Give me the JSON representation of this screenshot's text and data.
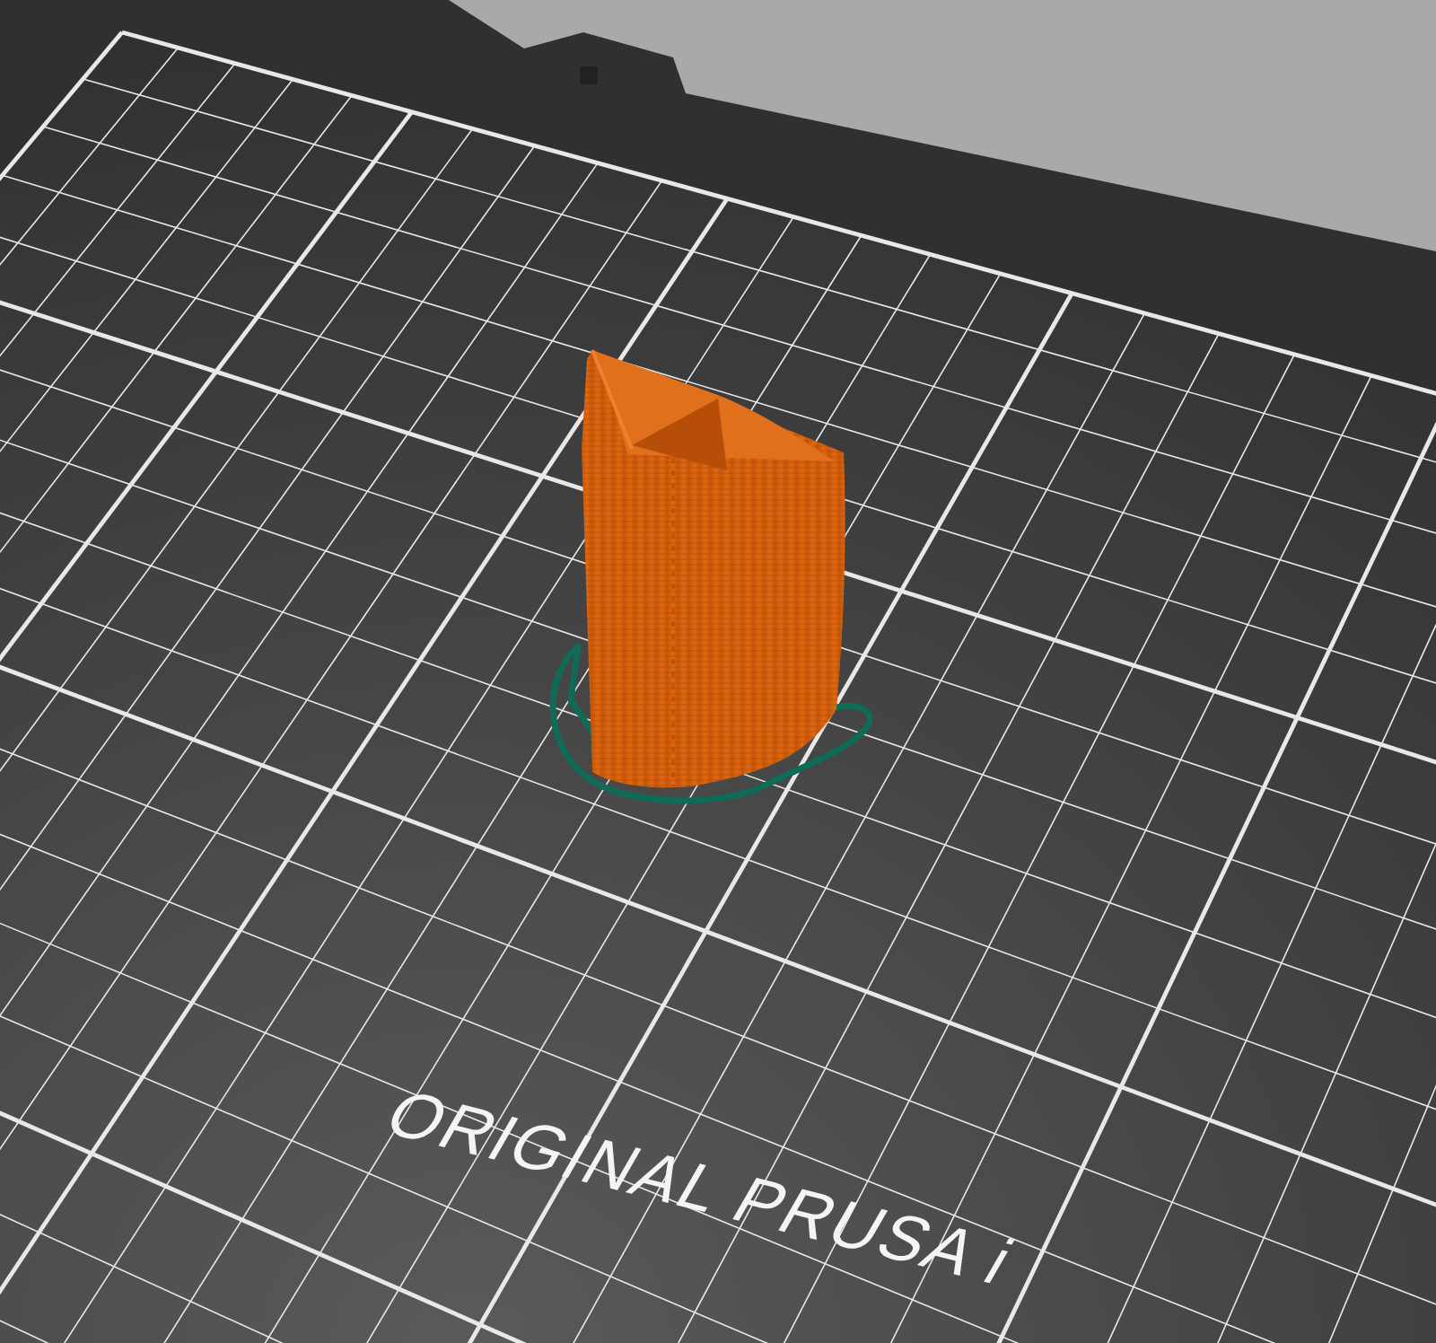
{
  "viewport": {
    "bed_label": "ORIGINAL PRUSA i"
  }
}
